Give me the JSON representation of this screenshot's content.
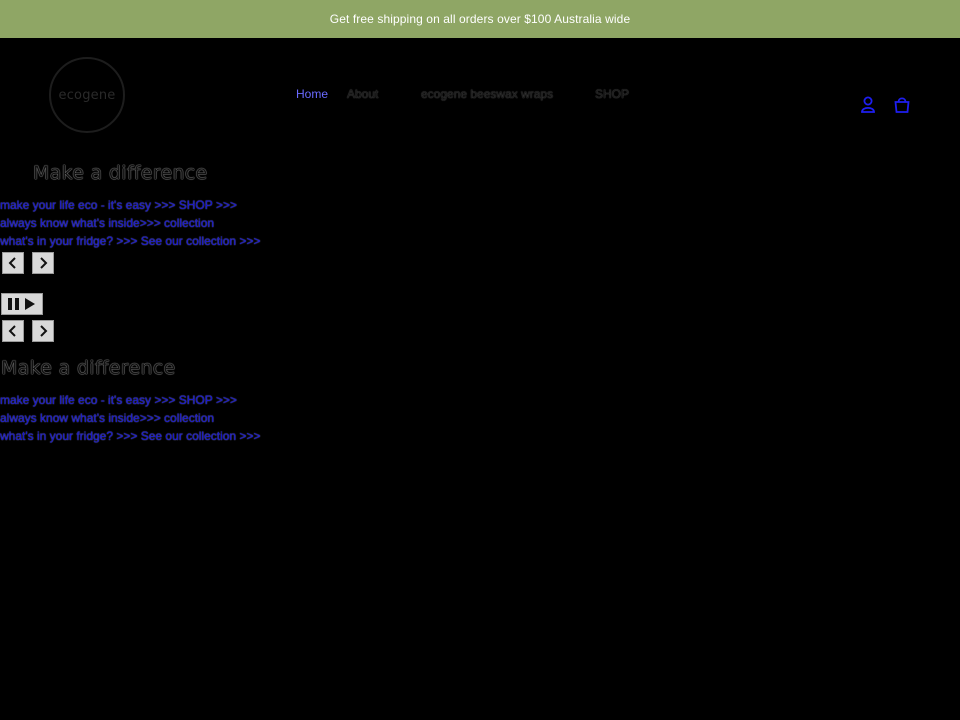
{
  "announcement": {
    "text": "Get free shipping on all orders over $100 Australia wide"
  },
  "logo": {
    "text": "ecogene"
  },
  "nav": {
    "items": [
      {
        "label": "Home"
      },
      {
        "label": "About"
      },
      {
        "label": "ecogene beeswax wraps"
      },
      {
        "label": "SHOP"
      }
    ]
  },
  "header_icons": [
    "account-icon",
    "cart-icon"
  ],
  "slideshow": {
    "heading": "Make a difference",
    "links": [
      "make your life eco - it's easy >>> SHOP >>>",
      "always know what's inside>>> collection",
      "what's in your fridge? >>> See our collection >>>"
    ],
    "controls": {
      "prev_icon": "chevron-left-icon",
      "next_icon": "chevron-right-icon",
      "pause_icon": "pause-play-icon"
    }
  },
  "colors": {
    "announcement_bg": "#8fa665",
    "page_bg": "#000000",
    "link": "#1515c8",
    "active_nav": "#6a6aff"
  }
}
